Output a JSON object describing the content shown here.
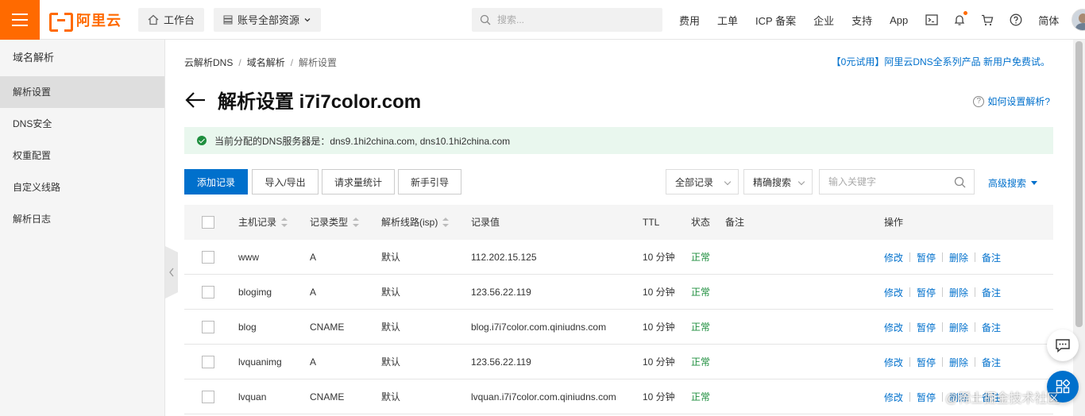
{
  "brand": {
    "logo_text": "阿里云",
    "accent": "#ff6a00",
    "primary": "#0070cc"
  },
  "topbar": {
    "workbench": "工作台",
    "resources": "账号全部资源",
    "search_placeholder": "搜索...",
    "links": [
      "费用",
      "工单",
      "ICP 备案",
      "企业",
      "支持",
      "App"
    ],
    "lang": "简体",
    "icons": [
      "terminal-icon",
      "bell-icon",
      "cart-icon",
      "help-icon"
    ]
  },
  "sidebar": {
    "title": "域名解析",
    "items": [
      {
        "label": "解析设置",
        "active": true
      },
      {
        "label": "DNS安全"
      },
      {
        "label": "权重配置"
      },
      {
        "label": "自定义线路"
      },
      {
        "label": "解析日志"
      }
    ]
  },
  "breadcrumb": [
    "云解析DNS",
    "域名解析",
    "解析设置"
  ],
  "promo": "【0元试用】阿里云DNS全系列产品 新用户免费试。",
  "page_title": "解析设置 i7i7color.com",
  "help_link": "如何设置解析?",
  "notice": "当前分配的DNS服务器是：dns9.1hi2china.com, dns10.1hi2china.com",
  "toolbar": {
    "add": "添加记录",
    "import_export": "导入/导出",
    "stats": "请求量统计",
    "guide": "新手引导",
    "filter_select": "全部记录",
    "search_mode": "精确搜索",
    "keyword_placeholder": "输入关键字",
    "advanced": "高级搜索"
  },
  "table": {
    "headers": {
      "host": "主机记录",
      "type": "记录类型",
      "line": "解析线路(isp)",
      "value": "记录值",
      "ttl": "TTL",
      "status": "状态",
      "remark": "备注",
      "ops": "操作"
    },
    "op_labels": [
      "修改",
      "暂停",
      "删除",
      "备注"
    ],
    "rows": [
      {
        "host": "www",
        "type": "A",
        "line": "默认",
        "value": "112.202.15.125",
        "ttl": "10 分钟",
        "status": "正常"
      },
      {
        "host": "blogimg",
        "type": "A",
        "line": "默认",
        "value": "123.56.22.119",
        "ttl": "10 分钟",
        "status": "正常"
      },
      {
        "host": "blog",
        "type": "CNAME",
        "line": "默认",
        "value": "blog.i7i7color.com.qiniudns.com",
        "ttl": "10 分钟",
        "status": "正常"
      },
      {
        "host": "lvquanimg",
        "type": "A",
        "line": "默认",
        "value": "123.56.22.119",
        "ttl": "10 分钟",
        "status": "正常"
      },
      {
        "host": "lvquan",
        "type": "CNAME",
        "line": "默认",
        "value": "lvquan.i7i7color.com.qiniudns.com",
        "ttl": "10 分钟",
        "status": "正常"
      }
    ]
  },
  "watermark": "@稀土掘金技术社区"
}
